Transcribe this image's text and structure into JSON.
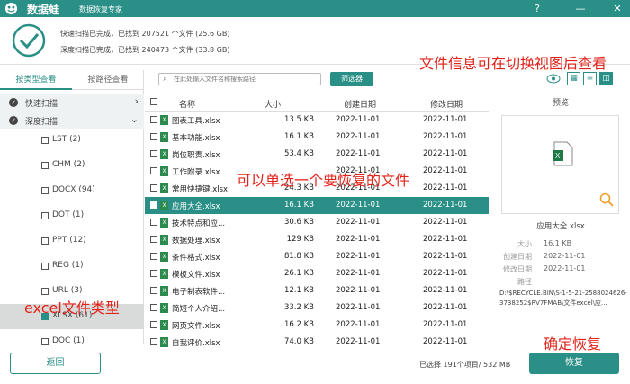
{
  "app": {
    "brand": "数据蛙",
    "slogan": "数据恢复专家"
  },
  "window": {
    "help": "?",
    "minimize": "—",
    "close": "✕"
  },
  "scan": {
    "quick": "快速扫描已完成，已找到 207521 个文件 (25.6 GB)",
    "deep": "深度扫描已完成，已找到 240473 个文件 (33.8 GB)"
  },
  "left_tabs": {
    "by_type": "按类型查看",
    "by_path": "按路径查看"
  },
  "tree": {
    "quick_scan": "快速扫描",
    "deep_scan": "深度扫描",
    "items": [
      {
        "label": "LST (2)"
      },
      {
        "label": "CHM (2)"
      },
      {
        "label": "DOCX (94)"
      },
      {
        "label": "DOT (1)"
      },
      {
        "label": "PPT (12)"
      },
      {
        "label": "REG (1)"
      },
      {
        "label": "URL (3)"
      },
      {
        "label": "XLSX (61)"
      },
      {
        "label": "DOC (1)"
      }
    ]
  },
  "search": {
    "placeholder": "在此处输入文件名称搜索路径"
  },
  "filter_label": "筛选器",
  "table": {
    "headers": {
      "name": "名称",
      "size": "大小",
      "created": "创建日期",
      "modified": "修改日期"
    },
    "rows": [
      {
        "name": "图表工具.xlsx",
        "size": "13.5 KB",
        "created": "2022-11-01",
        "modified": "2022-11-01"
      },
      {
        "name": "基本功能.xlsx",
        "size": "16.1 KB",
        "created": "2022-11-01",
        "modified": "2022-11-01"
      },
      {
        "name": "岗位职责.xlsx",
        "size": "53.4 KB",
        "created": "2022-11-01",
        "modified": "2022-11-01"
      },
      {
        "name": "工作附录.xlsx",
        "size": "",
        "created": "2022-11-01",
        "modified": "2022-11-01"
      },
      {
        "name": "常用快捷键.xlsx",
        "size": "24.3 KB",
        "created": "2022-11-01",
        "modified": "2022-11-01"
      },
      {
        "name": "应用大全.xlsx",
        "size": "16.1 KB",
        "created": "2022-11-01",
        "modified": "2022-11-01"
      },
      {
        "name": "技术特点和应...",
        "size": "30.6 KB",
        "created": "2022-11-01",
        "modified": "2022-11-01"
      },
      {
        "name": "数据处理.xlsx",
        "size": "129 KB",
        "created": "2022-11-01",
        "modified": "2022-11-01"
      },
      {
        "name": "条件格式.xlsx",
        "size": "81.8 KB",
        "created": "2022-11-01",
        "modified": "2022-11-01"
      },
      {
        "name": "模板文件.xlsx",
        "size": "26.1 KB",
        "created": "2022-11-01",
        "modified": "2022-11-01"
      },
      {
        "name": "电子制表软件...",
        "size": "12.1 KB",
        "created": "2022-11-01",
        "modified": "2022-11-01"
      },
      {
        "name": "简短个人介绍...",
        "size": "33.2 KB",
        "created": "2022-11-01",
        "modified": "2022-11-01"
      },
      {
        "name": "网页文件.xlsx",
        "size": "16.2 KB",
        "created": "2022-11-01",
        "modified": "2022-11-01"
      },
      {
        "name": "自我评价.xlsx",
        "size": "74.0 KB",
        "created": "2022-11-01",
        "modified": "2022-11-01"
      }
    ]
  },
  "preview": {
    "title": "预览",
    "file_name": "应用大全.xlsx",
    "size_label": "大小",
    "size": "16.1 KB",
    "created_label": "创建日期",
    "created": "2022-11-01",
    "modified_label": "修改日期",
    "modified": "2022-11-01",
    "path_label": "路径",
    "path": "D:\\$RECYCLE.BIN\\S-1-5-21-2588024626-3738252$RV7FMAB\\文件excel\\应..."
  },
  "bottom": {
    "back": "返回",
    "selected_info": "已选择 191个项目/ 532 MB",
    "recover": "恢复"
  },
  "annotations": {
    "view_switch": "文件信息可在切换视图后查看",
    "single_select": "可以单选一个要恢复的文件",
    "excel_type": "excel文件类型",
    "confirm": "确定恢复"
  },
  "colors": {
    "accent": "#2a8f86",
    "annotation": "#e32219"
  }
}
